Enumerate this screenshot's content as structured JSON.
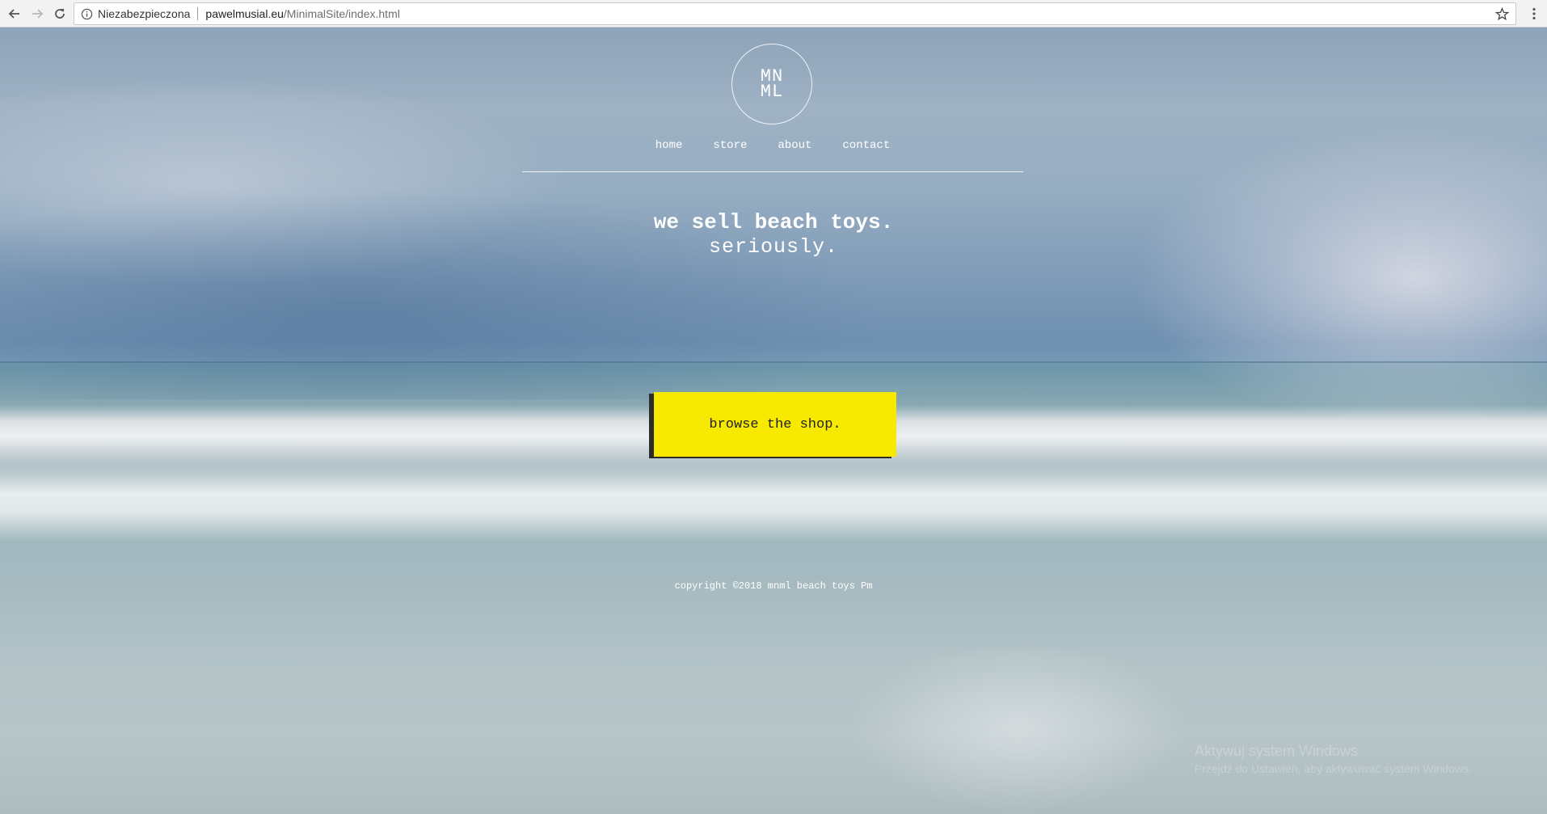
{
  "browser": {
    "security_label": "Niezabezpieczona",
    "url_host": "pawelmusial.eu",
    "url_path": "/MinimalSite/index.html",
    "icons": [
      "back-icon",
      "forward-icon",
      "reload-icon",
      "info-icon",
      "star-icon",
      "menu-icon"
    ]
  },
  "site": {
    "logo_line1": "MN",
    "logo_line2": "ML",
    "nav": {
      "home": "home",
      "store": "store",
      "about": "about",
      "contact": "contact"
    },
    "headline": "we sell beach toys.",
    "subline": "seriously.",
    "cta_label": "browse the shop.",
    "copyright": "copyright ©2018 mnml beach toys Pm",
    "accent_color": "#f7ea00"
  },
  "overlay": {
    "watermark_title": "Aktywuj system Windows",
    "watermark_sub": "Przejdź do Ustawień, aby aktywować system Windows."
  }
}
